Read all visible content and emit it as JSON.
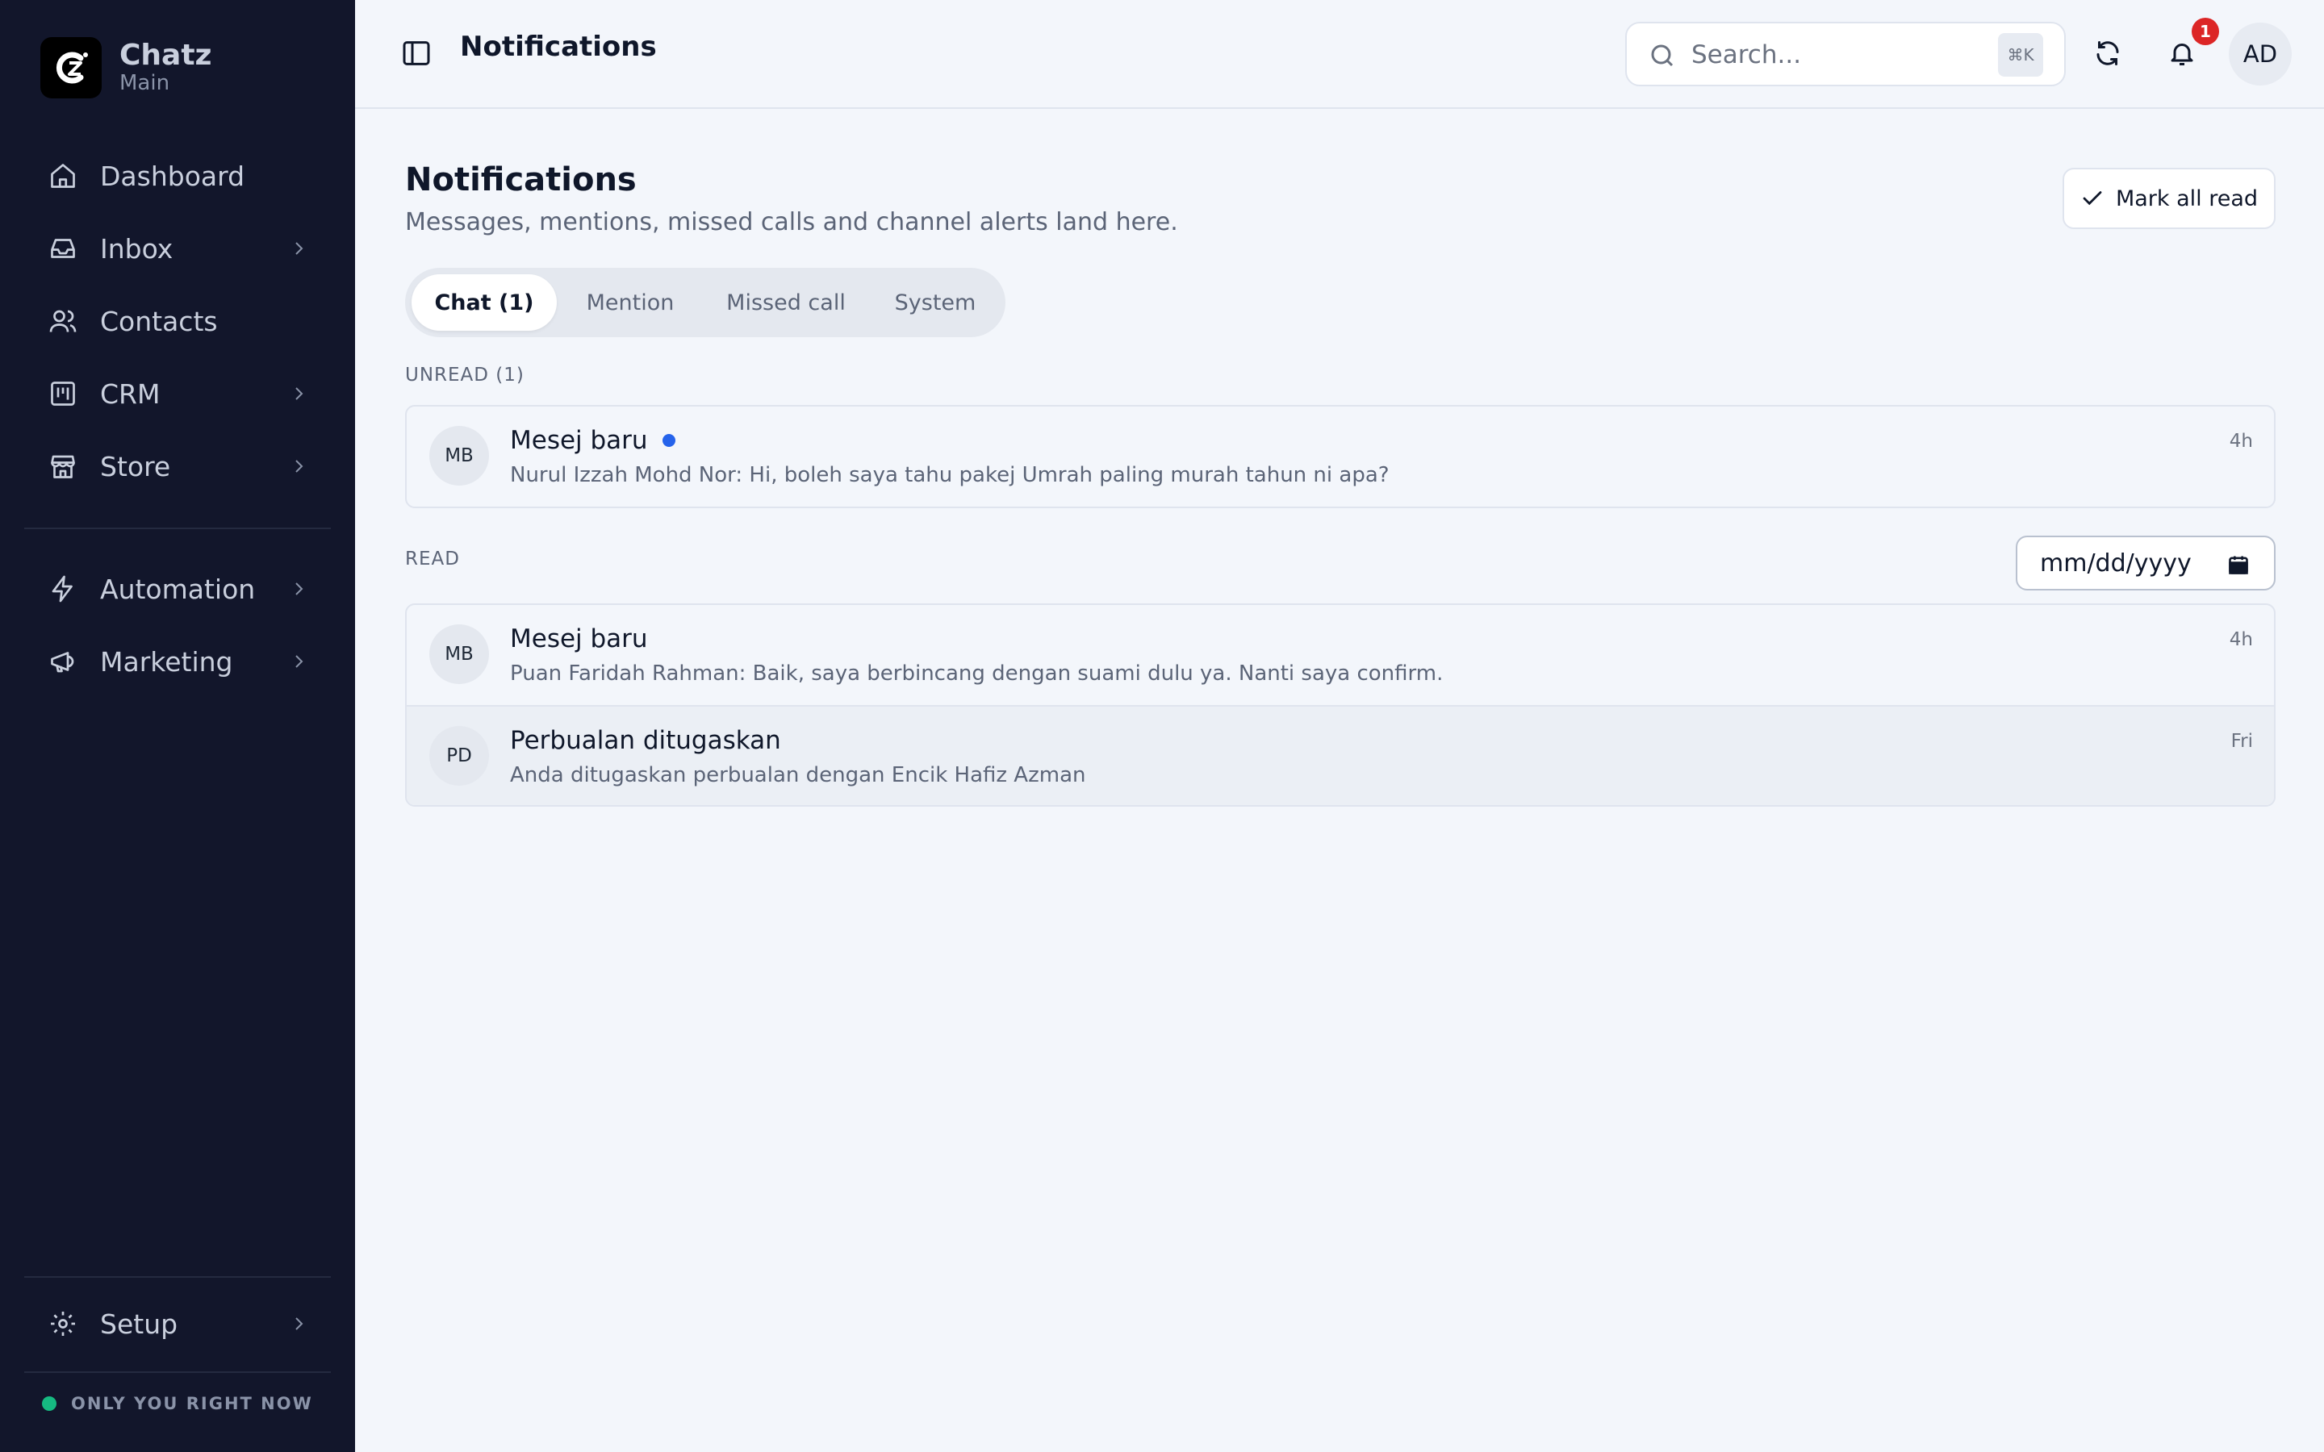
{
  "brand": {
    "name": "Chatz",
    "sub": "Main"
  },
  "sidebar": {
    "items": [
      {
        "label": "Dashboard",
        "icon": "home-icon",
        "chevron": false
      },
      {
        "label": "Inbox",
        "icon": "inbox-icon",
        "chevron": true
      },
      {
        "label": "Contacts",
        "icon": "users-icon",
        "chevron": false
      },
      {
        "label": "CRM",
        "icon": "kanban-icon",
        "chevron": true
      },
      {
        "label": "Store",
        "icon": "store-icon",
        "chevron": true
      },
      {
        "label": "Automation",
        "icon": "bolt-icon",
        "chevron": true
      },
      {
        "label": "Marketing",
        "icon": "megaphone-icon",
        "chevron": true
      }
    ],
    "setup": {
      "label": "Setup",
      "icon": "gear-icon"
    },
    "status": "ONLY YOU RIGHT NOW"
  },
  "topbar": {
    "title": "Notifications",
    "search_placeholder": "Search...",
    "search_shortcut": "⌘K",
    "notification_count": "1",
    "avatar": "AD"
  },
  "page": {
    "title": "Notifications",
    "subtitle": "Messages, mentions, missed calls and channel alerts land here.",
    "mark_all_read": "Mark all read",
    "tabs": [
      {
        "label": "Chat (1)",
        "active": true
      },
      {
        "label": "Mention",
        "active": false
      },
      {
        "label": "Missed call",
        "active": false
      },
      {
        "label": "System",
        "active": false
      }
    ],
    "unread_label": "UNREAD (1)",
    "read_label": "READ",
    "date_placeholder": "mm/dd/yyyy",
    "unread": [
      {
        "initials": "MB",
        "title": "Mesej baru",
        "text": "Nurul Izzah Mohd Nor: Hi, boleh saya tahu pakej Umrah paling murah tahun ni apa?",
        "time": "4h"
      }
    ],
    "read": [
      {
        "initials": "MB",
        "title": "Mesej baru",
        "text": "Puan Faridah Rahman: Baik, saya berbincang dengan suami dulu ya. Nanti saya confirm.",
        "time": "4h"
      },
      {
        "initials": "PD",
        "title": "Perbualan ditugaskan",
        "text": "Anda ditugaskan perbualan dengan Encik Hafiz Azman",
        "time": "Fri"
      }
    ]
  },
  "colors": {
    "sidebar_bg": "#12162b",
    "accent": "#2563eb",
    "badge": "#dc2626",
    "online": "#16b981"
  }
}
